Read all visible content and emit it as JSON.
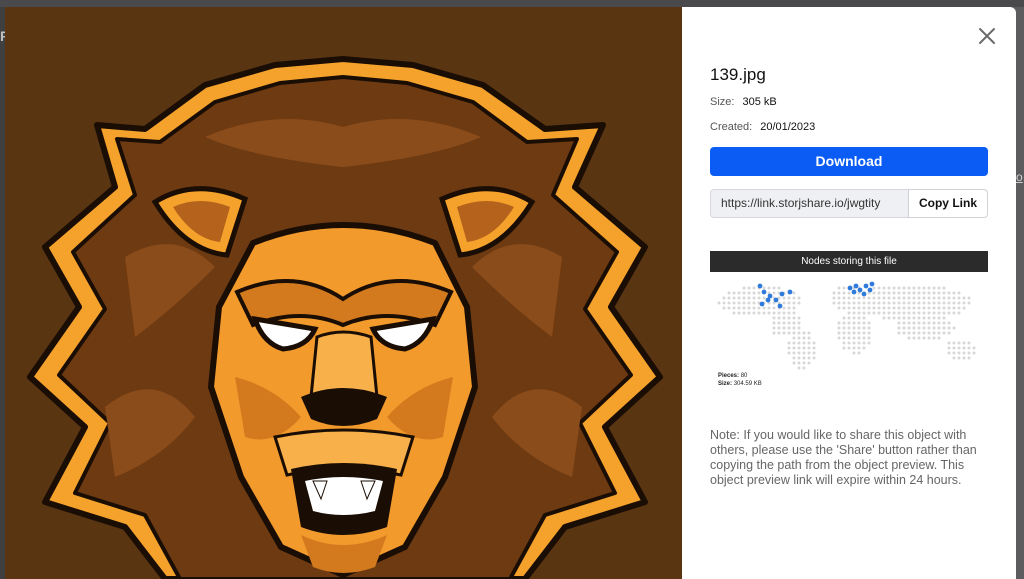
{
  "background": {
    "nav_glyph_r": "R",
    "nav_glyph_o": "o"
  },
  "preview": {
    "image_subject": "lion mascot illustration",
    "background_color": "#5a3512"
  },
  "details": {
    "file_name": "139.jpg",
    "size_label": "Size:",
    "size_value": "305 kB",
    "created_label": "Created:",
    "created_value": "20/01/2023",
    "download_label": "Download",
    "share_link": "https://link.storjshare.io/jwgtity",
    "copy_label": "Copy Link",
    "nodes_title": "Nodes storing this file",
    "pieces_label": "Pieces:",
    "pieces_value": "80",
    "map_size_label": "Size:",
    "map_size_value": "304.59 KB",
    "note": "Note: If you would like to share this object with others, please use the 'Share' button rather than copying the path from the object preview. This object preview link will expire within 24 hours."
  },
  "icons": {
    "close": "close-icon"
  },
  "colors": {
    "accent": "#0a5cf5",
    "node_dot": "#2f7bdc",
    "land_dot": "#d7d7d7"
  }
}
